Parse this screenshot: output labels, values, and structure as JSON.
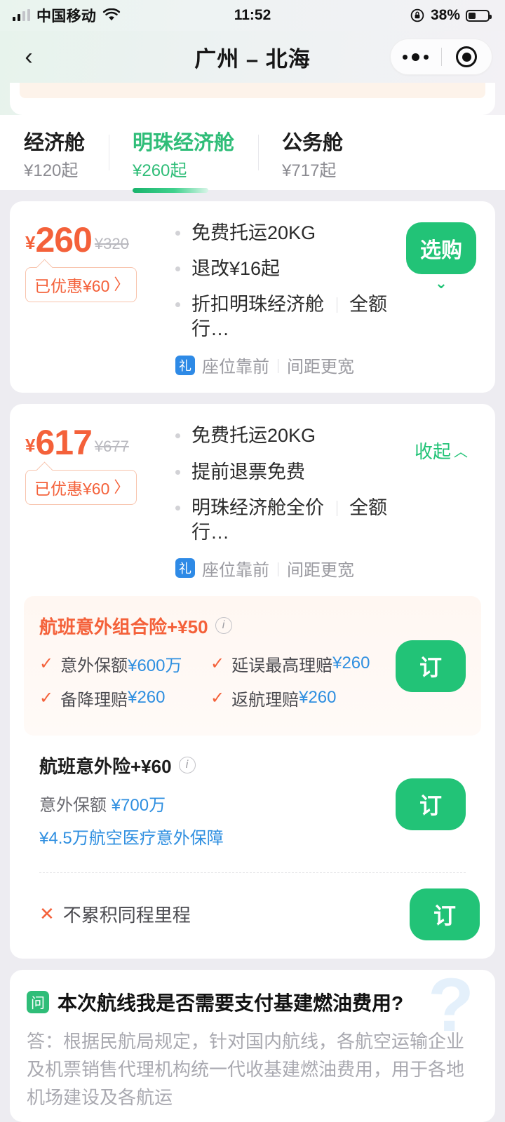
{
  "status_bar": {
    "carrier": "中国移动",
    "time": "11:52",
    "battery_percent": "38%",
    "battery_level": 38,
    "signal_icon": "signal-bars-icon",
    "wifi_icon": "wifi-icon",
    "rotation_lock_icon": "rotation-lock-icon",
    "battery_icon": "battery-icon"
  },
  "nav": {
    "back_icon": "‹",
    "title": "广州 – 北海",
    "more_icon": "more-dots-icon",
    "target_icon": "target-circle-icon"
  },
  "tabs": [
    {
      "name": "经济舱",
      "price": "¥120起",
      "active": false
    },
    {
      "name": "明珠经济舱",
      "price": "¥260起",
      "active": true
    },
    {
      "name": "公务舱",
      "price": "¥717起",
      "active": false
    }
  ],
  "fares": [
    {
      "currency": "¥",
      "price": "260",
      "original_price": "¥320",
      "discount_tag": "已优惠¥60",
      "discount_chevron": "〉",
      "features": [
        {
          "main": "免费托运20KG",
          "extra": ""
        },
        {
          "main": "退改¥16起",
          "extra": ""
        },
        {
          "main": "折扣明珠经济舱",
          "extra": "全额行…"
        }
      ],
      "perk_badge": "礼",
      "perks": [
        "座位靠前",
        "间距更宽"
      ],
      "action_type": "button",
      "action_label": "选购",
      "action_sub_icon": "chevron-down-icon"
    },
    {
      "currency": "¥",
      "price": "617",
      "original_price": "¥677",
      "discount_tag": "已优惠¥60",
      "discount_chevron": "〉",
      "features": [
        {
          "main": "免费托运20KG",
          "extra": ""
        },
        {
          "main": "提前退票免费",
          "extra": ""
        },
        {
          "main": "明珠经济舱全价",
          "extra": "全额行…"
        }
      ],
      "perk_badge": "礼",
      "perks": [
        "座位靠前",
        "间距更宽"
      ],
      "action_type": "link",
      "action_label": "收起",
      "action_sub_icon": "chevron-up-icon"
    }
  ],
  "insurance": {
    "combo": {
      "title": "航班意外组合险+¥50",
      "info_icon": "info-icon",
      "items": [
        {
          "label": "意外保额",
          "value": "¥600万"
        },
        {
          "label": "延误最高理赔",
          "value": "¥260"
        },
        {
          "label": "备降理赔",
          "value": "¥260"
        },
        {
          "label": "返航理赔",
          "value": "¥260"
        }
      ],
      "order_label": "订"
    },
    "single": {
      "title": "航班意外险+¥60",
      "info_icon": "info-icon",
      "line1_label": "意外保额",
      "line1_value": "¥700万",
      "line2": "¥4.5万航空医疗意外保障",
      "order_label": "订"
    },
    "mileage": {
      "cross_icon": "✕",
      "text": "不累积同程里程",
      "order_label": "订"
    }
  },
  "faq": {
    "badge": "问",
    "question": "本次航线我是否需要支付基建燃油费用?",
    "answer": "答：根据民航局规定，针对国内航线，各航空运输企业及机票销售代理机构统一代收基建燃油费用，用于各地机场建设及各航运",
    "watermark": "?"
  },
  "colors": {
    "accent_green": "#22c377",
    "price_orange": "#f4613a",
    "link_blue": "#2f8fe0",
    "page_bg": "#edecf1"
  }
}
